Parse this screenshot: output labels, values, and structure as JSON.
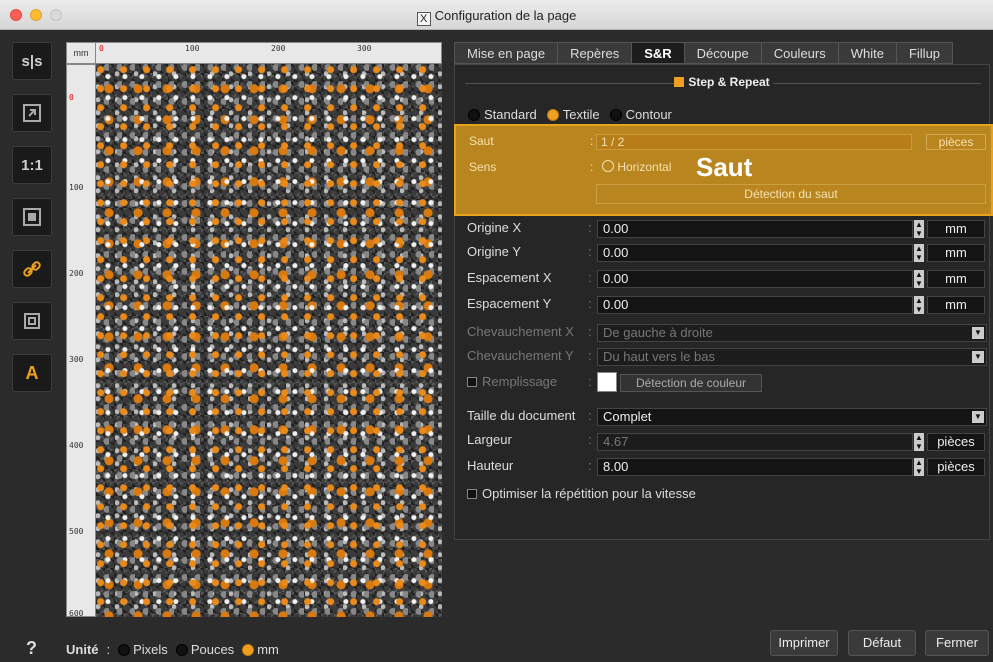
{
  "window": {
    "title": "Configuration de la page",
    "app_icon": "X"
  },
  "toolbar": {
    "tools": [
      "s|s",
      "arrow-box-icon",
      "1:1",
      "fit-page-icon",
      "link-icon",
      "crop-icon",
      "text-tool-icon"
    ],
    "label_sis": "s|s",
    "label_1to1": "1:1",
    "label_text": "A"
  },
  "rulers": {
    "unit": "mm",
    "top_labels": [
      "0",
      "100",
      "200",
      "300"
    ],
    "left_labels": [
      "0",
      "100",
      "200",
      "300",
      "400",
      "500",
      "600"
    ]
  },
  "tabs": [
    {
      "label": "Mise en page",
      "active": false
    },
    {
      "label": "Repères",
      "active": false
    },
    {
      "label": "S&R",
      "active": true
    },
    {
      "label": "Découpe",
      "active": false
    },
    {
      "label": "Couleurs",
      "active": false
    },
    {
      "label": "White",
      "active": false
    },
    {
      "label": "Fillup",
      "active": false
    }
  ],
  "section": {
    "title": "Step & Repeat"
  },
  "mode": {
    "options": [
      "Standard",
      "Textile",
      "Contour"
    ],
    "selected": "Textile"
  },
  "saut": {
    "label": "Saut",
    "value": "1 / 2",
    "unit": "pièces",
    "sens_label": "Sens",
    "sens_options": [
      "Horizontal"
    ],
    "overlay_text": "Saut",
    "detect_button": "Détection du saut"
  },
  "fields": {
    "origine_x": {
      "label": "Origine X",
      "value": "0.00",
      "unit": "mm"
    },
    "origine_y": {
      "label": "Origine Y",
      "value": "0.00",
      "unit": "mm"
    },
    "espacement_x": {
      "label": "Espacement X",
      "value": "0.00",
      "unit": "mm"
    },
    "espacement_y": {
      "label": "Espacement Y",
      "value": "0.00",
      "unit": "mm"
    },
    "chevauchement_x": {
      "label": "Chevauchement X",
      "value": "De gauche à droite"
    },
    "chevauchement_y": {
      "label": "Chevauchement Y",
      "value": "Du haut vers le bas"
    },
    "remplissage": {
      "label": "Remplissage",
      "button": "Détection de couleur"
    },
    "taille": {
      "label": "Taille du document",
      "value": "Complet"
    },
    "largeur": {
      "label": "Largeur",
      "value": "4.67",
      "unit": "pièces"
    },
    "hauteur": {
      "label": "Hauteur",
      "value": "8.00",
      "unit": "pièces"
    },
    "optimiser": {
      "label": "Optimiser la répétition pour la vitesse"
    }
  },
  "units_bar": {
    "label": "Unité",
    "options": [
      "Pixels",
      "Pouces",
      "mm"
    ],
    "selected": "mm"
  },
  "help": "?",
  "buttons": {
    "print": "Imprimer",
    "default": "Défaut",
    "close": "Fermer"
  },
  "colors": {
    "accent": "#f0a020",
    "highlight": "#d29620"
  }
}
